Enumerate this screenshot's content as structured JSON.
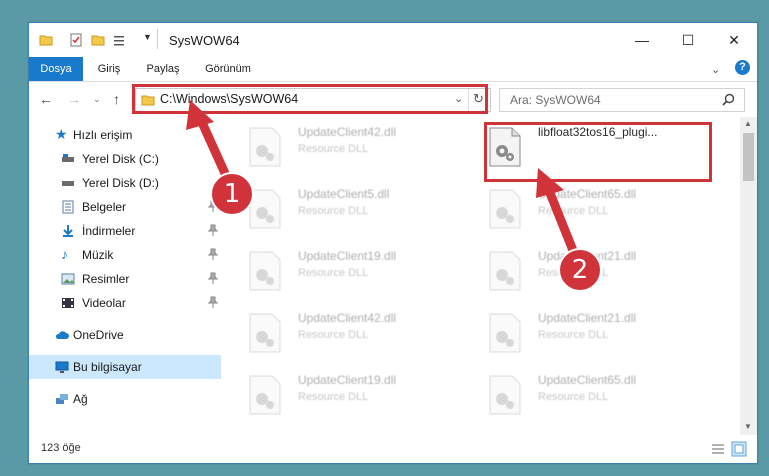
{
  "window": {
    "title": "SysWOW64"
  },
  "ribbon": {
    "tabs": [
      "Dosya",
      "Giriş",
      "Paylaş",
      "Görünüm"
    ]
  },
  "address": {
    "path": "C:\\Windows\\SysWOW64"
  },
  "search": {
    "placeholder": "Ara: SysWOW64"
  },
  "sidebar": {
    "quick_access": "Hızlı erişim",
    "items": [
      "Yerel Disk (C:)",
      "Yerel Disk (D:)",
      "Belgeler",
      "İndirmeler",
      "Müzik",
      "Resimler",
      "Videolar"
    ],
    "onedrive": "OneDrive",
    "this_pc": "Bu bilgisayar",
    "network": "Ağ"
  },
  "files": [
    {
      "name": "UpdateClient42.dll",
      "type": "Resource DLL"
    },
    {
      "name": "libfloat32tos16_plugi...",
      "type": ""
    },
    {
      "name": "UpdateClient5.dll",
      "type": "Resource DLL"
    },
    {
      "name": "UpdateClient65.dll",
      "type": "Resource DLL"
    },
    {
      "name": "UpdateClient19.dll",
      "type": "Resource DLL"
    },
    {
      "name": "UpdateClient21.dll",
      "type": "Resource DLL"
    },
    {
      "name": "UpdateClient42.dll",
      "type": "Resource DLL"
    },
    {
      "name": "UpdateClient21.dll",
      "type": "Resource DLL"
    },
    {
      "name": "UpdateClient19.dll",
      "type": "Resource DLL"
    },
    {
      "name": "UpdateClient65.dll",
      "type": "Resource DLL"
    }
  ],
  "status": {
    "count": "123 öğe"
  },
  "annotations": {
    "step1": "1",
    "step2": "2",
    "color": "#d0343a"
  }
}
